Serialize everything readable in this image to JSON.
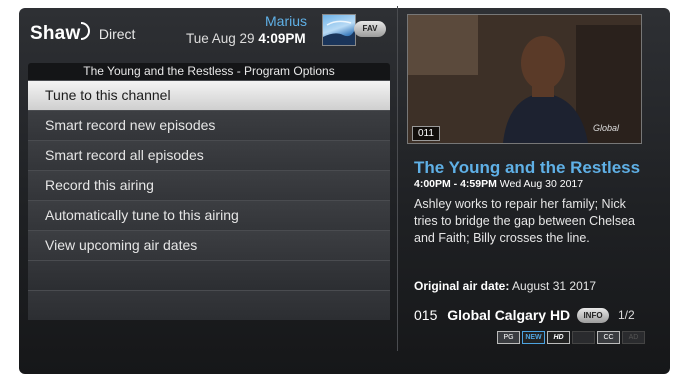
{
  "header": {
    "brand": "Shaw",
    "brand_sub": "Direct",
    "user_name": "Marius",
    "date": "Tue Aug 29",
    "time": "4:09PM",
    "fav_label": "FAV"
  },
  "menu": {
    "title": "The Young and the Restless - Program Options",
    "items": [
      {
        "label": "Tune to this channel",
        "selected": true
      },
      {
        "label": "Smart record new episodes"
      },
      {
        "label": "Smart record all episodes"
      },
      {
        "label": "Record this airing"
      },
      {
        "label": "Automatically tune to this airing"
      },
      {
        "label": "View upcoming air dates"
      }
    ]
  },
  "preview": {
    "channel_badge": "011",
    "network_logo": "Global"
  },
  "program": {
    "title": "The Young and the Restless",
    "time_range": "4:00PM - 4:59PM",
    "date": "Wed Aug 30 2017",
    "description": "Ashley works to repair her family; Nick tries to bridge the gap between Chelsea and Faith; Billy crosses the line.",
    "original_air_label": "Original air date:",
    "original_air_date": "August 31 2017",
    "channel_number": "015",
    "channel_name": "Global Calgary HD",
    "info_label": "INFO",
    "page": "1/2",
    "badges": [
      "PG",
      "NEW",
      "HD",
      "",
      "CC",
      "AD"
    ]
  },
  "colors": {
    "accent": "#5fb0e6",
    "selected_bg": "#f0f0f0",
    "panel_bg": "#2a2c30"
  }
}
